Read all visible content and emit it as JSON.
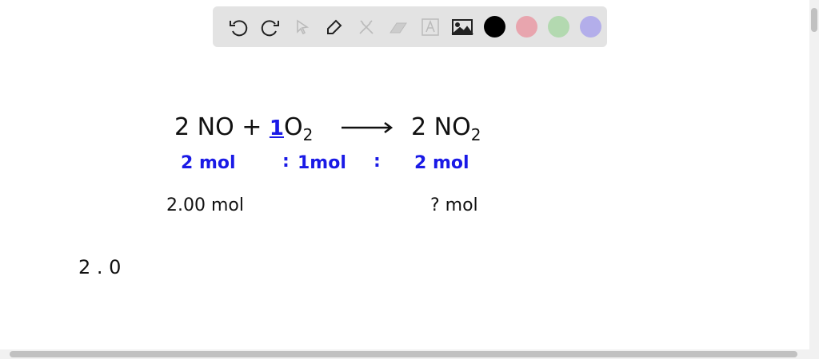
{
  "toolbar": {
    "tools": [
      "undo-icon",
      "redo-icon",
      "select-icon",
      "pen-icon",
      "tools-icon",
      "eraser-icon",
      "text-icon",
      "image-icon"
    ],
    "colors": [
      "#000000",
      "#e8a5ae",
      "#b3d9b0",
      "#b3aeea"
    ]
  },
  "board": {
    "eq_left": "2 NO +",
    "eq_coef": "1",
    "eq_o": "O",
    "eq_sub": "2",
    "eq_right": "2 NO",
    "eq_right_sub": "2",
    "ratio1": "2 mol",
    "colon1": ":",
    "ratio2": "1mol",
    "colon2": ":",
    "ratio3": "2 mol",
    "given": "2.00 mol",
    "unknown": "? mol",
    "work": "2 . 0"
  }
}
